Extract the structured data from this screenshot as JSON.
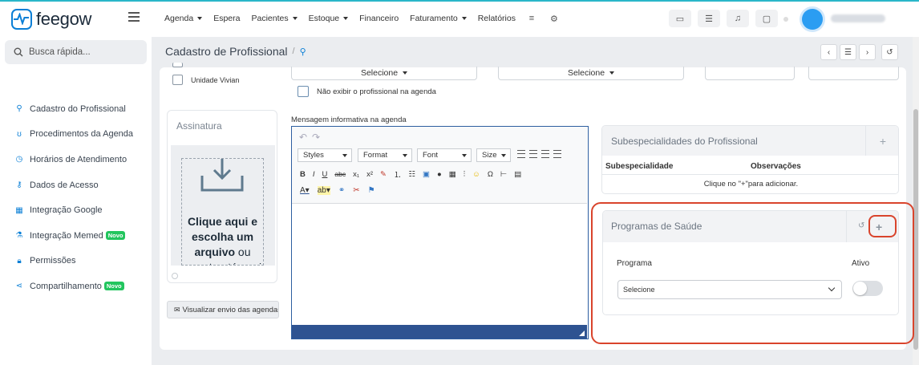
{
  "app": {
    "logo_text": "feegow"
  },
  "nav": [
    {
      "label": "Agenda",
      "caret": true
    },
    {
      "label": "Espera",
      "caret": false
    },
    {
      "label": "Pacientes",
      "caret": true
    },
    {
      "label": "Estoque",
      "caret": true
    },
    {
      "label": "Financeiro",
      "caret": false
    },
    {
      "label": "Faturamento",
      "caret": true
    },
    {
      "label": "Relatórios",
      "caret": false
    }
  ],
  "search": {
    "placeholder": "Busca rápida..."
  },
  "sidebar": {
    "items": [
      {
        "label": "Cadastro do Profissional",
        "icon": "user-icon"
      },
      {
        "label": "Procedimentos da Agenda",
        "icon": "stethoscope-icon"
      },
      {
        "label": "Horários de Atendimento",
        "icon": "clock-icon"
      },
      {
        "label": "Dados de Acesso",
        "icon": "key-icon"
      },
      {
        "label": "Integração Google",
        "icon": "calendar-icon"
      },
      {
        "label": "Integração Memed",
        "icon": "flask-icon",
        "badge": "Novo"
      },
      {
        "label": "Permissões",
        "icon": "lock-icon"
      },
      {
        "label": "Compartilhamento",
        "icon": "share-icon",
        "badge": "Novo"
      }
    ]
  },
  "page": {
    "title": "Cadastro de Profissional",
    "separator": "/"
  },
  "units": [
    "Unidade Vivian"
  ],
  "selects": {
    "left": "Selecione",
    "right": "Selecione"
  },
  "no_display": {
    "label": "Não exibir o profissional na agenda"
  },
  "signature": {
    "title": "Assinatura",
    "drop_bold": "Clique aqui e escolha um arquivo",
    "drop_rest": " ou arraste até aqui",
    "view_button": "Visualizar envio das agendas"
  },
  "editor": {
    "label": "Mensagem informativa na agenda",
    "combos": [
      "Styles",
      "Format",
      "Font",
      "Size"
    ],
    "row2": [
      "B",
      "I",
      "U",
      "abc",
      "x₁",
      "x²"
    ]
  },
  "subspecialties": {
    "title": "Subespecialidades do Profissional",
    "headers": [
      "Subespecialidade",
      "Observações"
    ],
    "empty": "Clique no \"+\"para adicionar."
  },
  "health_programs": {
    "title": "Programas de Saúde",
    "col_program": "Programa",
    "col_active": "Ativo",
    "select_value": "Selecione",
    "active": false
  },
  "colors": {
    "brand": "#0a7fd6",
    "highlight": "#d9442c",
    "badge": "#22c55e",
    "editor_bar": "#2e5391"
  }
}
